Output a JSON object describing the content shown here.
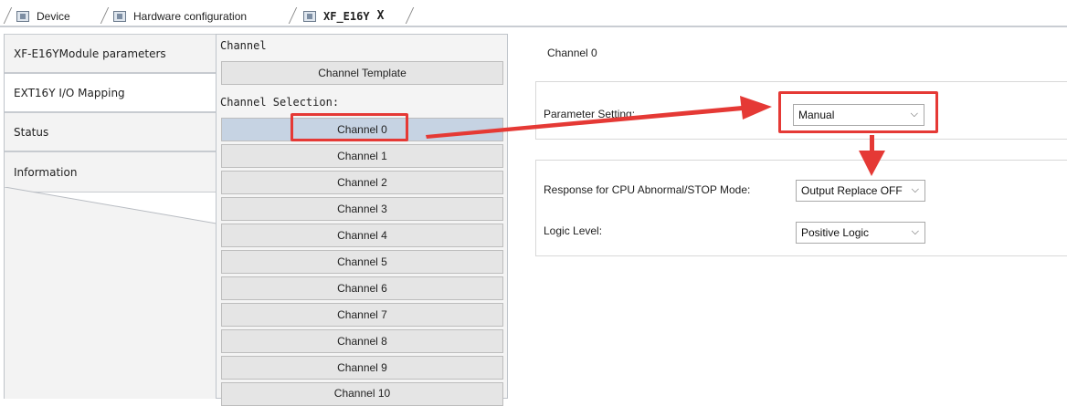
{
  "tabs": [
    {
      "label": "Device"
    },
    {
      "label": "Hardware configuration"
    },
    {
      "label": "XF_E16Y",
      "close": "X"
    }
  ],
  "leftnav": {
    "items": [
      {
        "label": "XF-E16YModule parameters"
      },
      {
        "label": "EXT16Y I/O Mapping"
      },
      {
        "label": "Status"
      },
      {
        "label": "Information"
      }
    ]
  },
  "channel_panel": {
    "header": "Channel",
    "template_button": "Channel Template",
    "selection_label": "Channel Selection:",
    "channels": [
      "Channel 0",
      "Channel 1",
      "Channel 2",
      "Channel 3",
      "Channel 4",
      "Channel 5",
      "Channel 6",
      "Channel 7",
      "Channel 8",
      "Channel 9",
      "Channel 10"
    ],
    "selected": "Channel 0"
  },
  "settings": {
    "title": "Channel 0",
    "parameter_setting_label": "Parameter Setting:",
    "parameter_setting_value": "Manual",
    "cpu_response_label": "Response for CPU Abnormal/STOP Mode:",
    "cpu_response_value": "Output Replace OFF",
    "logic_level_label": "Logic Level:",
    "logic_level_value": "Positive Logic"
  },
  "annotation_color": "#e53935",
  "icons": [
    "device-icon",
    "hardware-config-icon",
    "module-icon",
    "close-icon",
    "chevron-down-icon",
    "annotation-arrow"
  ]
}
